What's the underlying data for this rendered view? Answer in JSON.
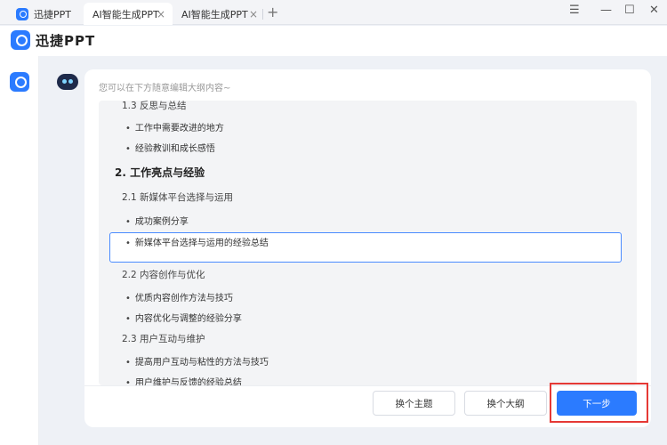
{
  "tabs": {
    "home": "迅捷PPT",
    "active": "AI智能生成PPT",
    "second": "AI智能生成PPT",
    "close_glyph": "×",
    "add_glyph": "+"
  },
  "window_controls": {
    "menu": "☰",
    "minimize": "—",
    "maximize": "☐",
    "close": "✕"
  },
  "brand": {
    "name": "迅捷PPT"
  },
  "main": {
    "hint": "您可以在下方随意编辑大纲内容~",
    "outline": [
      {
        "kind": "h3",
        "text": "1.3  反思与总结"
      },
      {
        "kind": "bullet",
        "text": "工作中需要改进的地方"
      },
      {
        "kind": "bullet",
        "text": "经验教训和成长感悟"
      },
      {
        "kind": "h2",
        "text": "2. 工作亮点与经验"
      },
      {
        "kind": "h3",
        "text": "2.1  新媒体平台选择与运用"
      },
      {
        "kind": "bullet",
        "text": "成功案例分享"
      },
      {
        "kind": "bullet",
        "text": "新媒体平台选择与运用的经验总结"
      },
      {
        "kind": "h3",
        "text": "2.2  内容创作与优化"
      },
      {
        "kind": "bullet",
        "text": "优质内容创作方法与技巧"
      },
      {
        "kind": "bullet",
        "text": "内容优化与调整的经验分享"
      },
      {
        "kind": "h3",
        "text": "2.3  用户互动与维护"
      },
      {
        "kind": "bullet",
        "text": "提高用户互动与粘性的方法与技巧"
      },
      {
        "kind": "bullet",
        "text": "用户维护与反馈的经验总结"
      }
    ],
    "buttons": {
      "change_theme": "换个主题",
      "change_outline": "换个大纲",
      "next": "下一步"
    }
  }
}
